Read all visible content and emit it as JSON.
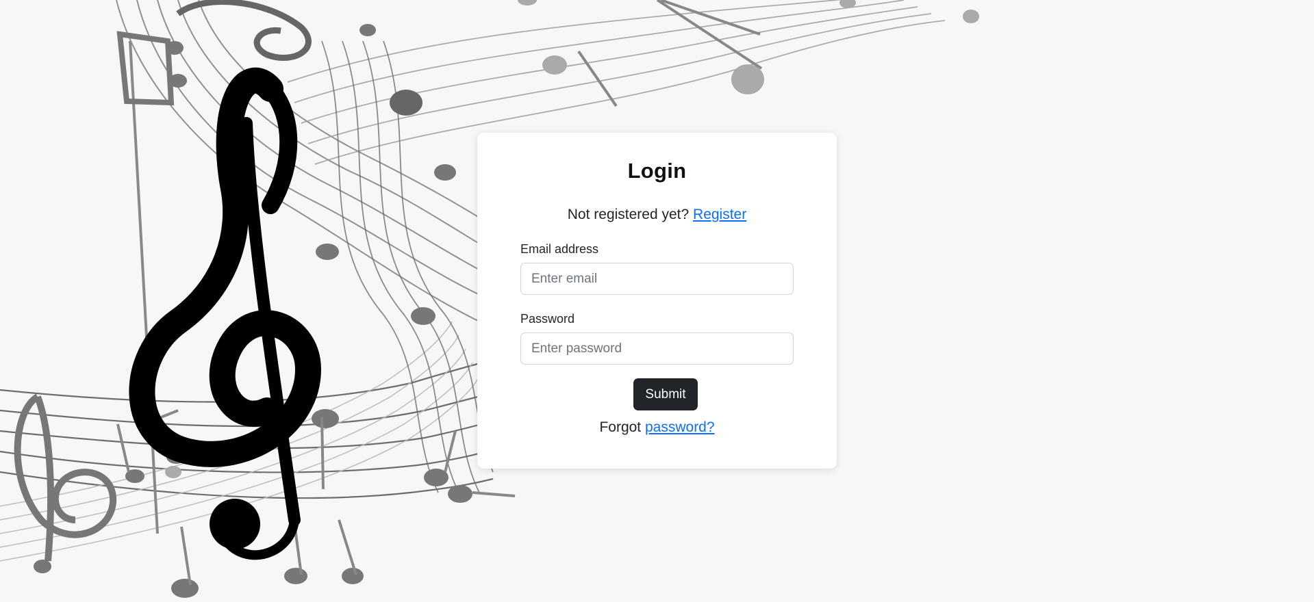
{
  "login": {
    "title": "Login",
    "register_prompt": "Not registered yet? ",
    "register_link": "Register",
    "email_label": "Email address",
    "email_placeholder": "Enter email",
    "email_value": "",
    "password_label": "Password",
    "password_placeholder": "Enter password",
    "password_value": "",
    "submit_label": "Submit",
    "forgot_prefix": "Forgot ",
    "forgot_link": "password?"
  },
  "background": {
    "art_icon": "music-staff-treble-clef-icon"
  }
}
